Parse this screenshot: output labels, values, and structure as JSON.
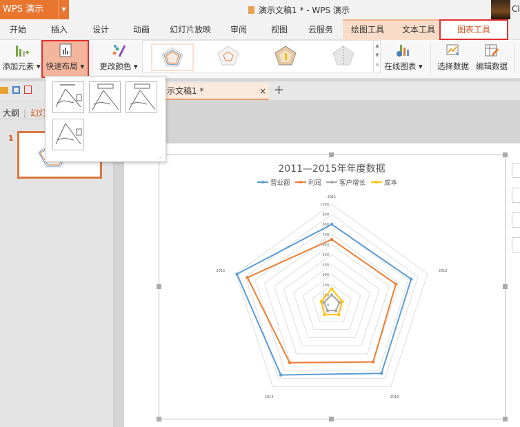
{
  "titlebar": {
    "app_button": "WPS 演示",
    "doc_title": "演示文稿1 * - WPS 演示",
    "user_short": "Cl"
  },
  "tabs": [
    "开始",
    "插入",
    "设计",
    "动画",
    "幻灯片放映",
    "审阅",
    "视图",
    "云服务",
    "绘图工具",
    "文本工具",
    "图表工具"
  ],
  "ribbon": {
    "add_element": "添加元素",
    "quick_layout": "快速布局",
    "change_color": "更改颜色",
    "online_chart": "在线图表",
    "select_data": "选择数据",
    "edit_data": "编辑数据"
  },
  "doc_tab": {
    "name": "示文稿1 *",
    "close": "×",
    "add": "+"
  },
  "left_panel": {
    "outline": "大纲",
    "slides": "幻灯片",
    "slide_number": "1"
  },
  "colors": {
    "accent": "#e8762f",
    "blue": "#5b9bd5",
    "orange": "#ed7d31",
    "gray": "#a5a5a5",
    "yellow": "#ffc000"
  },
  "chart_data": {
    "type": "radar",
    "title": "2011—2015年年度数据",
    "categories": [
      "2011",
      "2012",
      "2013",
      "2014",
      "2015"
    ],
    "ylim": [
      0,
      1000
    ],
    "ticks": [
      0,
      100,
      200,
      300,
      400,
      500,
      600,
      700,
      800,
      900,
      1000
    ],
    "legend_position": "top",
    "series": [
      {
        "name": "营业额",
        "color": "#5b9bd5",
        "values": [
          800,
          830,
          840,
          860,
          990
        ]
      },
      {
        "name": "利润",
        "color": "#ed7d31",
        "values": [
          650,
          670,
          700,
          710,
          880
        ]
      },
      {
        "name": "客户增长",
        "color": "#a5a5a5",
        "values": [
          100,
          80,
          70,
          70,
          80
        ]
      },
      {
        "name": "成本",
        "color": "#ffc000",
        "values": [
          160,
          110,
          120,
          120,
          110
        ]
      }
    ]
  }
}
